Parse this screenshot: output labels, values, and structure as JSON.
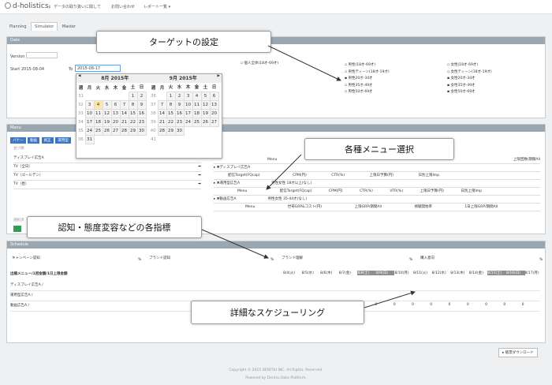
{
  "app": {
    "logo": "d-holistics",
    "logo_suffix": "β"
  },
  "nav": {
    "links": [
      "データの取り扱いに関して",
      "お問い合わせ",
      "レポート一覧 ▾"
    ]
  },
  "tabs": [
    "Planning",
    "Simulator",
    "Master"
  ],
  "date_panel": {
    "header": "Date",
    "version_label": "Version",
    "start_label": "Start",
    "start_value": "2015-08-04",
    "to_label": "To",
    "to_value": "2015-08-17"
  },
  "calendar": {
    "left_month": "8月 2015年",
    "right_month": "9月 2015年",
    "weekdays": [
      "週",
      "月",
      "火",
      "水",
      "木",
      "金",
      "土",
      "日"
    ],
    "left_weeks": [
      [
        "31",
        "",
        "",
        "",
        "",
        "",
        "1",
        "2"
      ],
      [
        "32",
        "3",
        "4",
        "5",
        "6",
        "7",
        "8",
        "9"
      ],
      [
        "33",
        "10",
        "11",
        "12",
        "13",
        "14",
        "15",
        "16"
      ],
      [
        "34",
        "17",
        "18",
        "19",
        "20",
        "21",
        "22",
        "23"
      ],
      [
        "35",
        "24",
        "25",
        "26",
        "27",
        "28",
        "29",
        "30"
      ],
      [
        "36",
        "31",
        "",
        "",
        "",
        "",
        "",
        ""
      ]
    ],
    "right_weeks": [
      [
        "36",
        "",
        "1",
        "2",
        "3",
        "4",
        "5",
        "6"
      ],
      [
        "37",
        "7",
        "8",
        "9",
        "10",
        "11",
        "12",
        "13"
      ],
      [
        "38",
        "14",
        "15",
        "16",
        "17",
        "18",
        "19",
        "20"
      ],
      [
        "39",
        "21",
        "22",
        "23",
        "24",
        "25",
        "26",
        "27"
      ],
      [
        "40",
        "28",
        "29",
        "30",
        "",
        "",
        "",
        ""
      ],
      [
        "41",
        "",
        "",
        "",
        "",
        "",
        "",
        ""
      ]
    ],
    "today": "4",
    "nav_prev": "◀",
    "nav_next": "▶"
  },
  "target": {
    "label": "個人全体(18才-69才)",
    "col1": [
      "男性(18才-69才)",
      "男性ティーン(18才-19才)",
      "男性20才-34才",
      "男性35才-49才",
      "男性50才-69才"
    ],
    "col2": [
      "女性(18才-69才)",
      "女性ティーン(18才-19才)",
      "女性20才-34才",
      "女性35才-49才",
      "女性50才-69才"
    ]
  },
  "menu_panel": {
    "header": "Menu",
    "buttons": [
      "バナー",
      "動画",
      "純正",
      "運用型"
    ],
    "list_label": "並び順",
    "items": [
      "ディスプレイ広告A",
      "TV（全日）",
      "TV（ゴールデン）",
      "TV（昼）"
    ],
    "select_label": "選択済",
    "menu_head": "Menu",
    "rule_head": "上限回数/期間All",
    "rows": [
      {
        "name": "ディスプレイ広告A"
      },
      {
        "name": "運用型広告A"
      },
      {
        "name": "動画広告A"
      }
    ],
    "row_cols_a": [
      "配信Target(FQcap)",
      "CPM(円)",
      "CTR(%)",
      "上限日予算(円)",
      "日別上限Imp"
    ],
    "row_cols_b": [
      "配信Target(FQcap)",
      "CPM(円)",
      "CTR(%)",
      "VTR(%)",
      "上限日予算(円)",
      "日別上限Imp"
    ],
    "row_cols_c": [
      "世帯GRP&コスト(円)",
      "上限GRP/期間All",
      "視聴開始率",
      "1日上限GRP/期間All"
    ],
    "target_val_a": "男性女性 18才以上(なし)",
    "target_val_b": "男性女性 35-44才(なし)"
  },
  "schedule": {
    "header": "Schedule",
    "kpis": [
      "キャンペーン認知",
      "ブランド認知",
      "ブランド理解",
      "購入意向"
    ],
    "pct": "%",
    "col_head": "出稿メニュー/1回金額/1日上限金額",
    "dates": [
      "8/4(火)",
      "8/5(水)",
      "8/6(木)",
      "8/7(金)",
      "8/8(土)",
      "8/9(日)",
      "8/10(月)",
      "8/11(火)",
      "8/12(水)",
      "8/13(木)",
      "8/14(金)",
      "8/15(土)",
      "8/16(日)",
      "8/17(月)"
    ],
    "rows": [
      {
        "name": "ディスプレイ広告A /",
        "cells": [
          "",
          "",
          "",
          "",
          "",
          "",
          "",
          "",
          "",
          "",
          "",
          "",
          "",
          ""
        ]
      },
      {
        "name": "運用型広告A /",
        "cells": [
          "0",
          "0",
          "0",
          "0",
          "0",
          "0",
          "0",
          "0",
          "0",
          "0",
          "0",
          "0",
          "0",
          "0"
        ]
      },
      {
        "name": "動画広告A /",
        "cells": [
          "",
          "",
          "",
          "",
          "",
          "",
          "",
          "",
          "",
          "",
          "",
          "",
          "",
          ""
        ]
      }
    ],
    "download_label": "▸ 帳票ダウンロード"
  },
  "callouts": {
    "target": "ターゲットの設定",
    "menu": "各種メニュー選択",
    "kpi": "認知・態度変容などの各指標",
    "schedule": "詳細なスケジューリング"
  },
  "footer": {
    "line1": "Copyright © 2015 DENTSU INC. All Rights. Reserved.",
    "line2": "Powered by Dentsu Data Platform."
  },
  "colors": {
    "accent": "#3a78c4",
    "panel_head": "#9aa7b1",
    "highlight": "#fce8a6"
  }
}
